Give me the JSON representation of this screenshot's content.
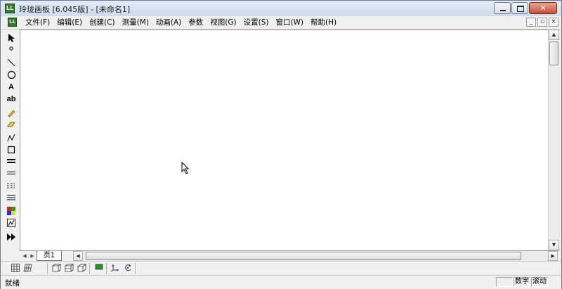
{
  "window": {
    "title": "玲珑画板 [6.045版] - [未命名1]",
    "app_icon_text": "LL"
  },
  "menu": {
    "items": [
      {
        "label": "文件(F)"
      },
      {
        "label": "编辑(E)"
      },
      {
        "label": "创建(C)"
      },
      {
        "label": "测量(M)"
      },
      {
        "label": "动画(A)"
      },
      {
        "label": "参数"
      },
      {
        "label": "视图(G)"
      },
      {
        "label": "设置(S)"
      },
      {
        "label": "窗口(W)"
      },
      {
        "label": "帮助(H)"
      }
    ]
  },
  "toolbox": {
    "text_tool_label": "A",
    "label_tool_label": "ab"
  },
  "pages": {
    "tabs": [
      {
        "label": "页1"
      }
    ]
  },
  "status": {
    "text": "就绪",
    "num_lock": "数字",
    "scroll_lock": "滚动"
  },
  "colors": {
    "app_green": "#2f7d2a",
    "canvas": "#ffffff",
    "chrome": "#f0f0f0"
  }
}
